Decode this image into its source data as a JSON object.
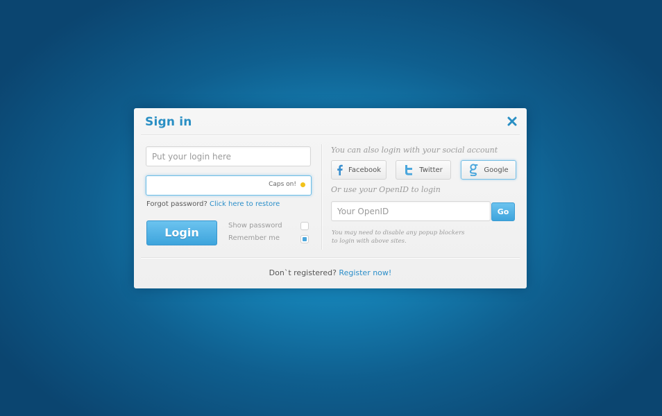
{
  "dialog": {
    "title": "Sign in",
    "close_icon": "close-icon"
  },
  "login": {
    "login_placeholder": "Put your login here",
    "password_value": "",
    "caps_text": "Caps on!",
    "forgot_text": "Forgot password?",
    "forgot_link": "Click here to restore",
    "login_button": "Login",
    "show_password_label": "Show password",
    "show_password_checked": false,
    "remember_label": "Remember me",
    "remember_checked": true
  },
  "social": {
    "note": "You can also login with your social account",
    "facebook_label": "Facebook",
    "facebook_icon": "facebook-icon",
    "twitter_label": "Twitter",
    "twitter_icon": "twitter-icon",
    "google_label": "Google",
    "google_icon": "google-icon",
    "openid_note": "Or use your OpenID to login",
    "openid_placeholder": "Your OpenID",
    "go_label": "Go",
    "popup_note_line1": "You may need to disable any popup blockers",
    "popup_note_line2": "to login with above sites."
  },
  "footer": {
    "register_text": "Don`t registered?",
    "register_link": "Register now!"
  },
  "colors": {
    "accent": "#2a8fc4",
    "button": "#4aa9de",
    "background": "#1684b8",
    "caps_indicator": "#f2c21a"
  }
}
